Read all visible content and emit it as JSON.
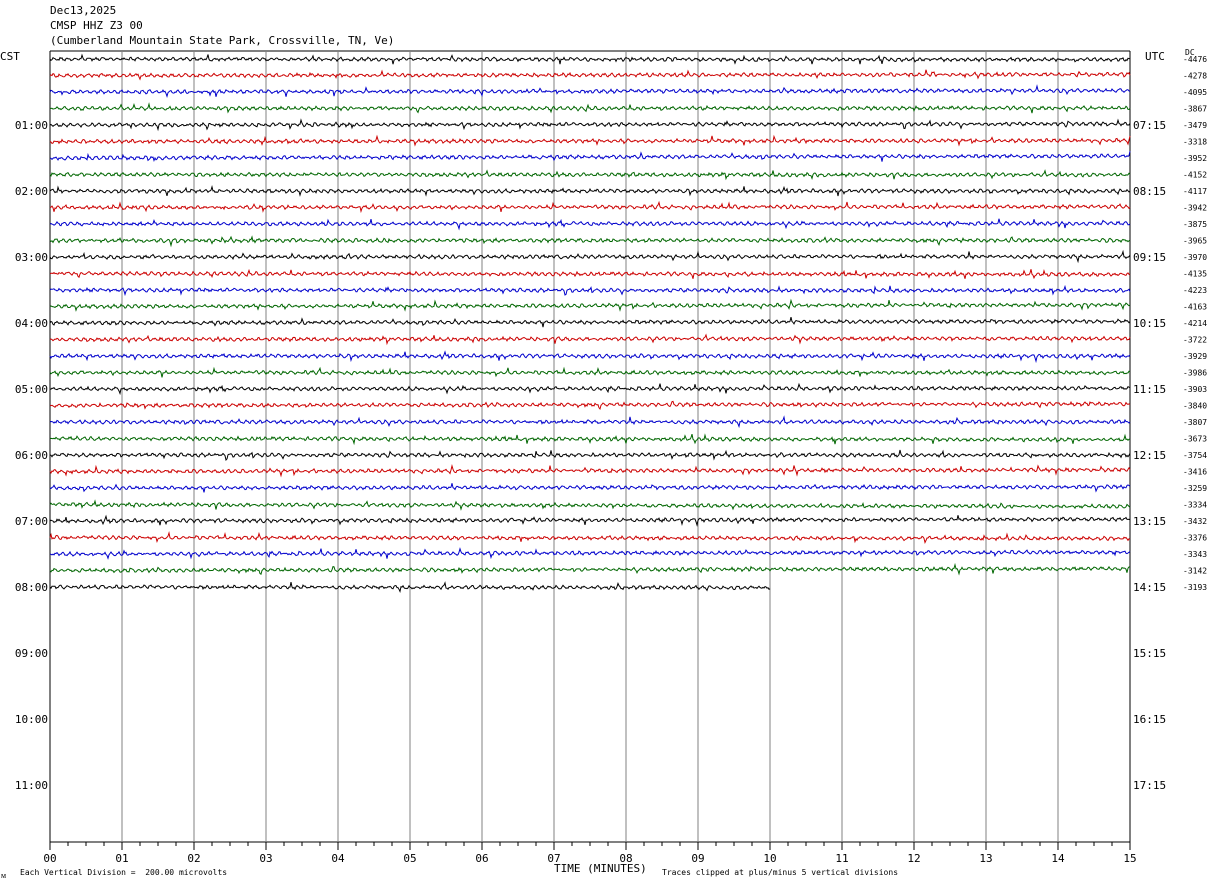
{
  "header": {
    "date": "Dec13,2025",
    "station": "CMSP HHZ Z3 00",
    "location": "(Cumberland Mountain State Park, Crossville, TN, Ve)"
  },
  "axes": {
    "left_zone": "CST",
    "right_zone": "UTC",
    "dc_label": "DC",
    "xlabel": "TIME (MINUTES)",
    "footer_left": "Each Vertical Division =  200.00 microvolts",
    "footer_right": "Traces clipped at plus/minus 5 vertical divisions",
    "corner_mark": "ᴍ"
  },
  "colors": {
    "cycle": [
      "#000000",
      "#cc0000",
      "#0000cc",
      "#006600"
    ],
    "grid": "#808080"
  },
  "chart_data": {
    "type": "line",
    "title": "CMSP HHZ Z3 00",
    "x_ticks": [
      "00",
      "01",
      "02",
      "03",
      "04",
      "05",
      "06",
      "07",
      "08",
      "09",
      "10",
      "11",
      "12",
      "13",
      "14",
      "15"
    ],
    "xlim": [
      0,
      15
    ],
    "left_hour_labels": [
      "01:00",
      "02:00",
      "03:00",
      "04:00",
      "05:00",
      "06:00",
      "07:00",
      "08:00",
      "09:00",
      "10:00",
      "11:00"
    ],
    "right_hour_labels": [
      "07:15",
      "08:15",
      "09:15",
      "10:15",
      "11:15",
      "12:15",
      "13:15",
      "14:15",
      "15:15",
      "16:15",
      "17:15"
    ],
    "trace_dc_offsets": [
      "-4476",
      "-4278",
      "-4095",
      "-3867",
      "-3479",
      "-3318",
      "-3952",
      "-4152",
      "-4117",
      "-3942",
      "-3875",
      "-3965",
      "-3970",
      "-4135",
      "-4223",
      "-4163",
      "-4214",
      "-3722",
      "-3929",
      "-3986",
      "-3903",
      "-3840",
      "-3807",
      "-3673",
      "-3754",
      "-3416",
      "-3259",
      "-3334",
      "-3432",
      "-3376",
      "-3343",
      "-3142",
      "-3193"
    ],
    "last_trace_end_minute": 10,
    "traces_per_hour": 4,
    "minutes_per_trace": 15
  }
}
